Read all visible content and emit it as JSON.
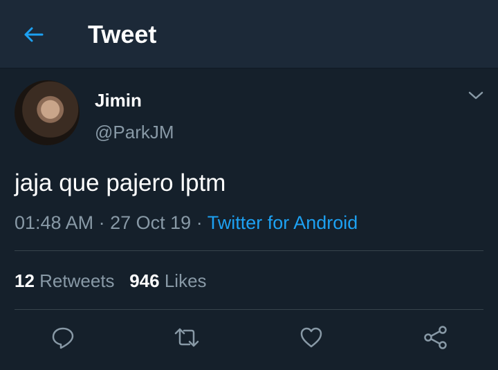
{
  "header": {
    "title": "Tweet",
    "back_icon": "arrow-left-icon"
  },
  "tweet": {
    "author_name": "Jimin",
    "author_handle": "@ParkJM",
    "text": "jaja que pajero lptm",
    "time": "01:48 AM",
    "sep1": "·",
    "date": "27 Oct 19",
    "sep2": "·",
    "source": "Twitter for Android"
  },
  "stats": {
    "retweets_count": "12",
    "retweets_label": "Retweets",
    "likes_count": "946",
    "likes_label": "Likes"
  },
  "actions": [
    "reply-icon",
    "retweet-icon",
    "like-icon",
    "share-icon"
  ],
  "colors": {
    "background": "#15202b",
    "header": "#1c2938",
    "accent": "#1da1f2",
    "secondary_text": "#8899a6",
    "divider": "#38444d"
  }
}
